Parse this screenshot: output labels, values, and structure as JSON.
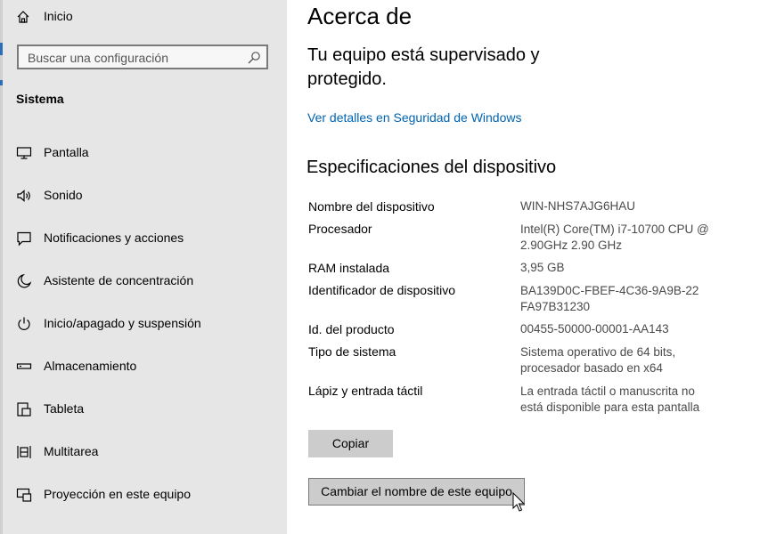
{
  "sidebar": {
    "home_label": "Inicio",
    "search_placeholder": "Buscar una configuración",
    "section_title": "Sistema",
    "items": [
      {
        "label": "Pantalla",
        "icon": "monitor-icon"
      },
      {
        "label": "Sonido",
        "icon": "speaker-icon"
      },
      {
        "label": "Notificaciones y acciones",
        "icon": "notification-icon"
      },
      {
        "label": "Asistente de concentración",
        "icon": "moon-icon"
      },
      {
        "label": "Inicio/apagado y suspensión",
        "icon": "power-icon"
      },
      {
        "label": "Almacenamiento",
        "icon": "storage-icon"
      },
      {
        "label": "Tableta",
        "icon": "tablet-icon"
      },
      {
        "label": "Multitarea",
        "icon": "multitask-icon"
      },
      {
        "label": "Proyección en este equipo",
        "icon": "projection-icon"
      }
    ]
  },
  "main": {
    "title": "Acerca de",
    "status": "Tu equipo está supervisado y protegido.",
    "security_link": "Ver detalles en Seguridad de Windows",
    "specs_title": "Especificaciones del dispositivo",
    "specs": [
      {
        "label": "Nombre del dispositivo",
        "value": "WIN-NHS7AJG6HAU"
      },
      {
        "label": "Procesador",
        "value": "Intel(R) Core(TM) i7-10700 CPU @ 2.90GHz   2.90 GHz"
      },
      {
        "label": "RAM instalada",
        "value": "3,95 GB"
      },
      {
        "label": "Identificador de dispositivo",
        "value": "BA139D0C-FBEF-4C36-9A9B-22FA97B31230"
      },
      {
        "label": "Id. del producto",
        "value": "00455-50000-00001-AA143"
      },
      {
        "label": "Tipo de sistema",
        "value": "Sistema operativo de 64 bits, procesador basado en x64"
      },
      {
        "label": "Lápiz y entrada táctil",
        "value": "La entrada táctil o manuscrita no está disponible para esta pantalla"
      }
    ],
    "copy_button": "Copiar",
    "rename_button": "Cambiar el nombre de este equipo"
  },
  "colors": {
    "sidebar_bg": "#e6e6e6",
    "link": "#0063b1",
    "button_bg": "#cccccc"
  }
}
